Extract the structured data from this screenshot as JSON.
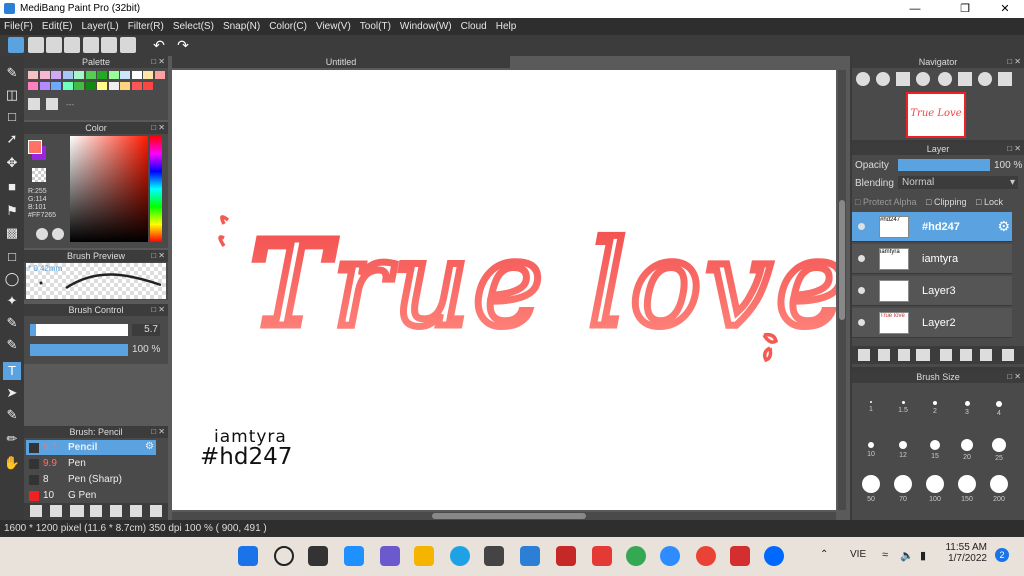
{
  "window": {
    "title": "MediBang Paint Pro (32bit)"
  },
  "menu": [
    "File(F)",
    "Edit(E)",
    "Layer(L)",
    "Filter(R)",
    "Select(S)",
    "Snap(N)",
    "Color(C)",
    "View(V)",
    "Tool(T)",
    "Window(W)",
    "Cloud",
    "Help"
  ],
  "panels": {
    "palette": {
      "title": "Palette",
      "empty_label": "---"
    },
    "color": {
      "title": "Color",
      "r": "R:255",
      "g": "G:114",
      "b": "B:101",
      "hex": "#FF7265",
      "fg": "#FF7265",
      "bg": "#9b26e0"
    },
    "brush_preview": {
      "title": "Brush Preview",
      "size": "* 0.42mm"
    },
    "brush_control": {
      "title": "Brush Control",
      "size": "5.7",
      "opacity": "100 %"
    },
    "brush_list": {
      "title": "Brush: Pencil",
      "items": [
        {
          "num": "5.7",
          "name": "Pencil"
        },
        {
          "num": "9.9",
          "name": "Pen"
        },
        {
          "num": "8",
          "name": "Pen (Sharp)"
        },
        {
          "num": "10",
          "name": "G Pen"
        }
      ]
    },
    "navigator": {
      "title": "Navigator",
      "thumb_text": "True Love"
    },
    "layer": {
      "title": "Layer",
      "opacity_label": "Opacity",
      "opacity_value": "100 %",
      "blending_label": "Blending",
      "blending_value": "Normal",
      "protect_alpha": "Protect Alpha",
      "clipping": "Clipping",
      "lock": "Lock",
      "layers": [
        {
          "name": "#hd247",
          "thumb": "#hd247"
        },
        {
          "name": "iamtyra",
          "thumb": "iamtyra"
        },
        {
          "name": "Layer3",
          "thumb": ""
        },
        {
          "name": "Layer2",
          "thumb": "True love"
        }
      ]
    },
    "brush_size": {
      "title": "Brush Size",
      "sizes": [
        "1",
        "1.5",
        "2",
        "3",
        "4",
        "10",
        "12",
        "15",
        "20",
        "25",
        "50",
        "70",
        "100",
        "150",
        "200"
      ]
    }
  },
  "canvas": {
    "tab": "Untitled",
    "lettering": "True love",
    "text_iamtyra": "iamtyra",
    "text_hash": "#hd247",
    "stroke_color": "#f5695f"
  },
  "status": {
    "text": "1600 * 1200 pixel   (11.6 * 8.7cm)   350 dpi   100 %   ( 900, 491 )"
  },
  "taskbar": {
    "lang": "VIE",
    "time": "11:55 AM",
    "date": "1/7/2022",
    "notif": "2"
  }
}
